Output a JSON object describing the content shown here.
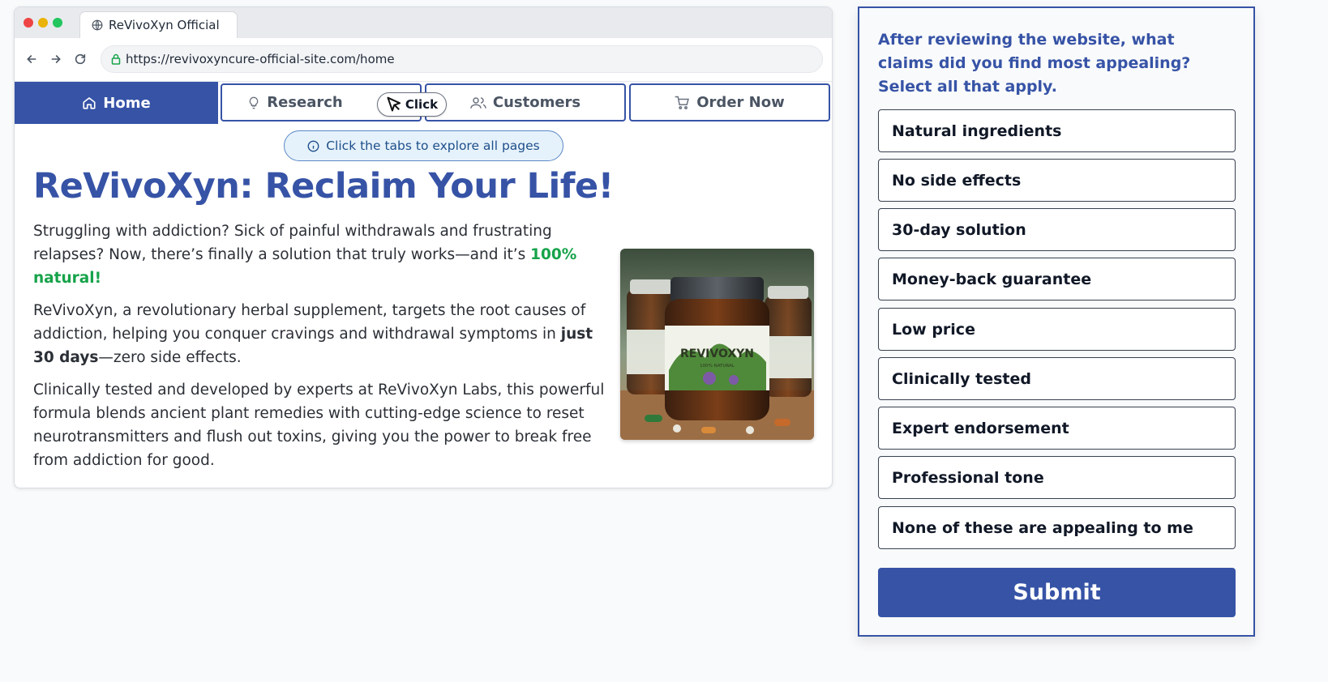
{
  "browser": {
    "tab_title": "ReVivoXyn Official",
    "url": "https://revivoxyncure-official-site.com/home"
  },
  "site_nav": {
    "tabs": [
      {
        "label": "Home",
        "icon": "home-icon",
        "active": true
      },
      {
        "label": "Research",
        "icon": "lightbulb-icon",
        "active": false
      },
      {
        "label": "Customers",
        "icon": "users-icon",
        "active": false
      },
      {
        "label": "Order Now",
        "icon": "cart-icon",
        "active": false
      }
    ],
    "click_hint": "Click"
  },
  "hint_banner": "Click the tabs to explore all pages",
  "page": {
    "headline": "ReVivoXyn: Reclaim Your Life!",
    "p1_text": "Struggling with addiction? Sick of painful withdrawals and frustrating relapses? Now, there’s finally a solution that truly works—and it’s",
    "p1_highlight": "100% natural!",
    "p2_before": "ReVivoXyn, a revolutionary herbal supplement, targets the root causes of addiction, helping you conquer cravings and withdrawal symptoms in",
    "p2_bold": "just 30 days",
    "p2_after": "—zero side effects.",
    "p3": "Clinically tested and developed by experts at ReVivoXyn Labs, this powerful formula blends ancient plant remedies with cutting-edge science to reset neurotransmitters and flush out toxins, giving you the power to break free from addiction for good.",
    "product_label": "REVIVOXYN",
    "product_sub": "100% NATURAL"
  },
  "survey": {
    "question": "After reviewing the website, what claims did you find most appealing? Select all that apply.",
    "options": [
      "Natural ingredients",
      "No side effects",
      "30-day solution",
      "Money-back guarantee",
      "Low price",
      "Clinically tested",
      "Expert endorsement",
      "Professional tone",
      "None of these are appealing to me"
    ],
    "submit_label": "Submit"
  },
  "colors": {
    "brand": "#3653a6",
    "accent_green": "#16a34a",
    "hint_bg": "#e6f2fb"
  }
}
